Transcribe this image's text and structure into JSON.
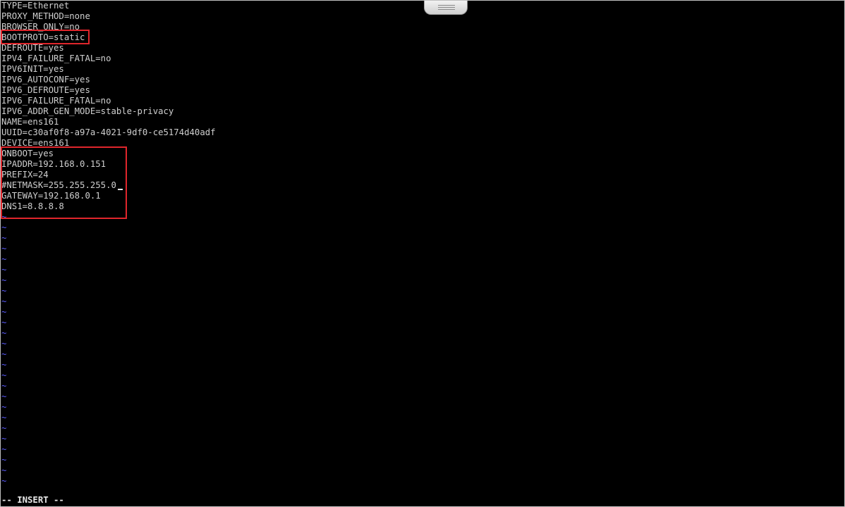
{
  "editor": {
    "lines": [
      "TYPE=Ethernet",
      "PROXY_METHOD=none",
      "BROWSER_ONLY=no",
      "BOOTPROTO=static",
      "DEFROUTE=yes",
      "IPV4_FAILURE_FATAL=no",
      "IPV6INIT=yes",
      "IPV6_AUTOCONF=yes",
      "IPV6_DEFROUTE=yes",
      "IPV6_FAILURE_FATAL=no",
      "IPV6_ADDR_GEN_MODE=stable-privacy",
      "NAME=ens161",
      "UUID=c30af0f8-a97a-4021-9df0-ce5174d40adf",
      "DEVICE=ens161",
      "ONBOOT=yes",
      "IPADDR=192.168.0.151",
      "PREFIX=24",
      "#NETMASK=255.255.255.0",
      "GATEWAY=192.168.0.1",
      "DNS1=8.8.8.8"
    ],
    "empty_line_marker": "~",
    "mode_status": "-- INSERT --"
  },
  "colors": {
    "background": "#000000",
    "text": "#cfcfcf",
    "tilde": "#5c5cff",
    "highlight": "#e0262c"
  }
}
